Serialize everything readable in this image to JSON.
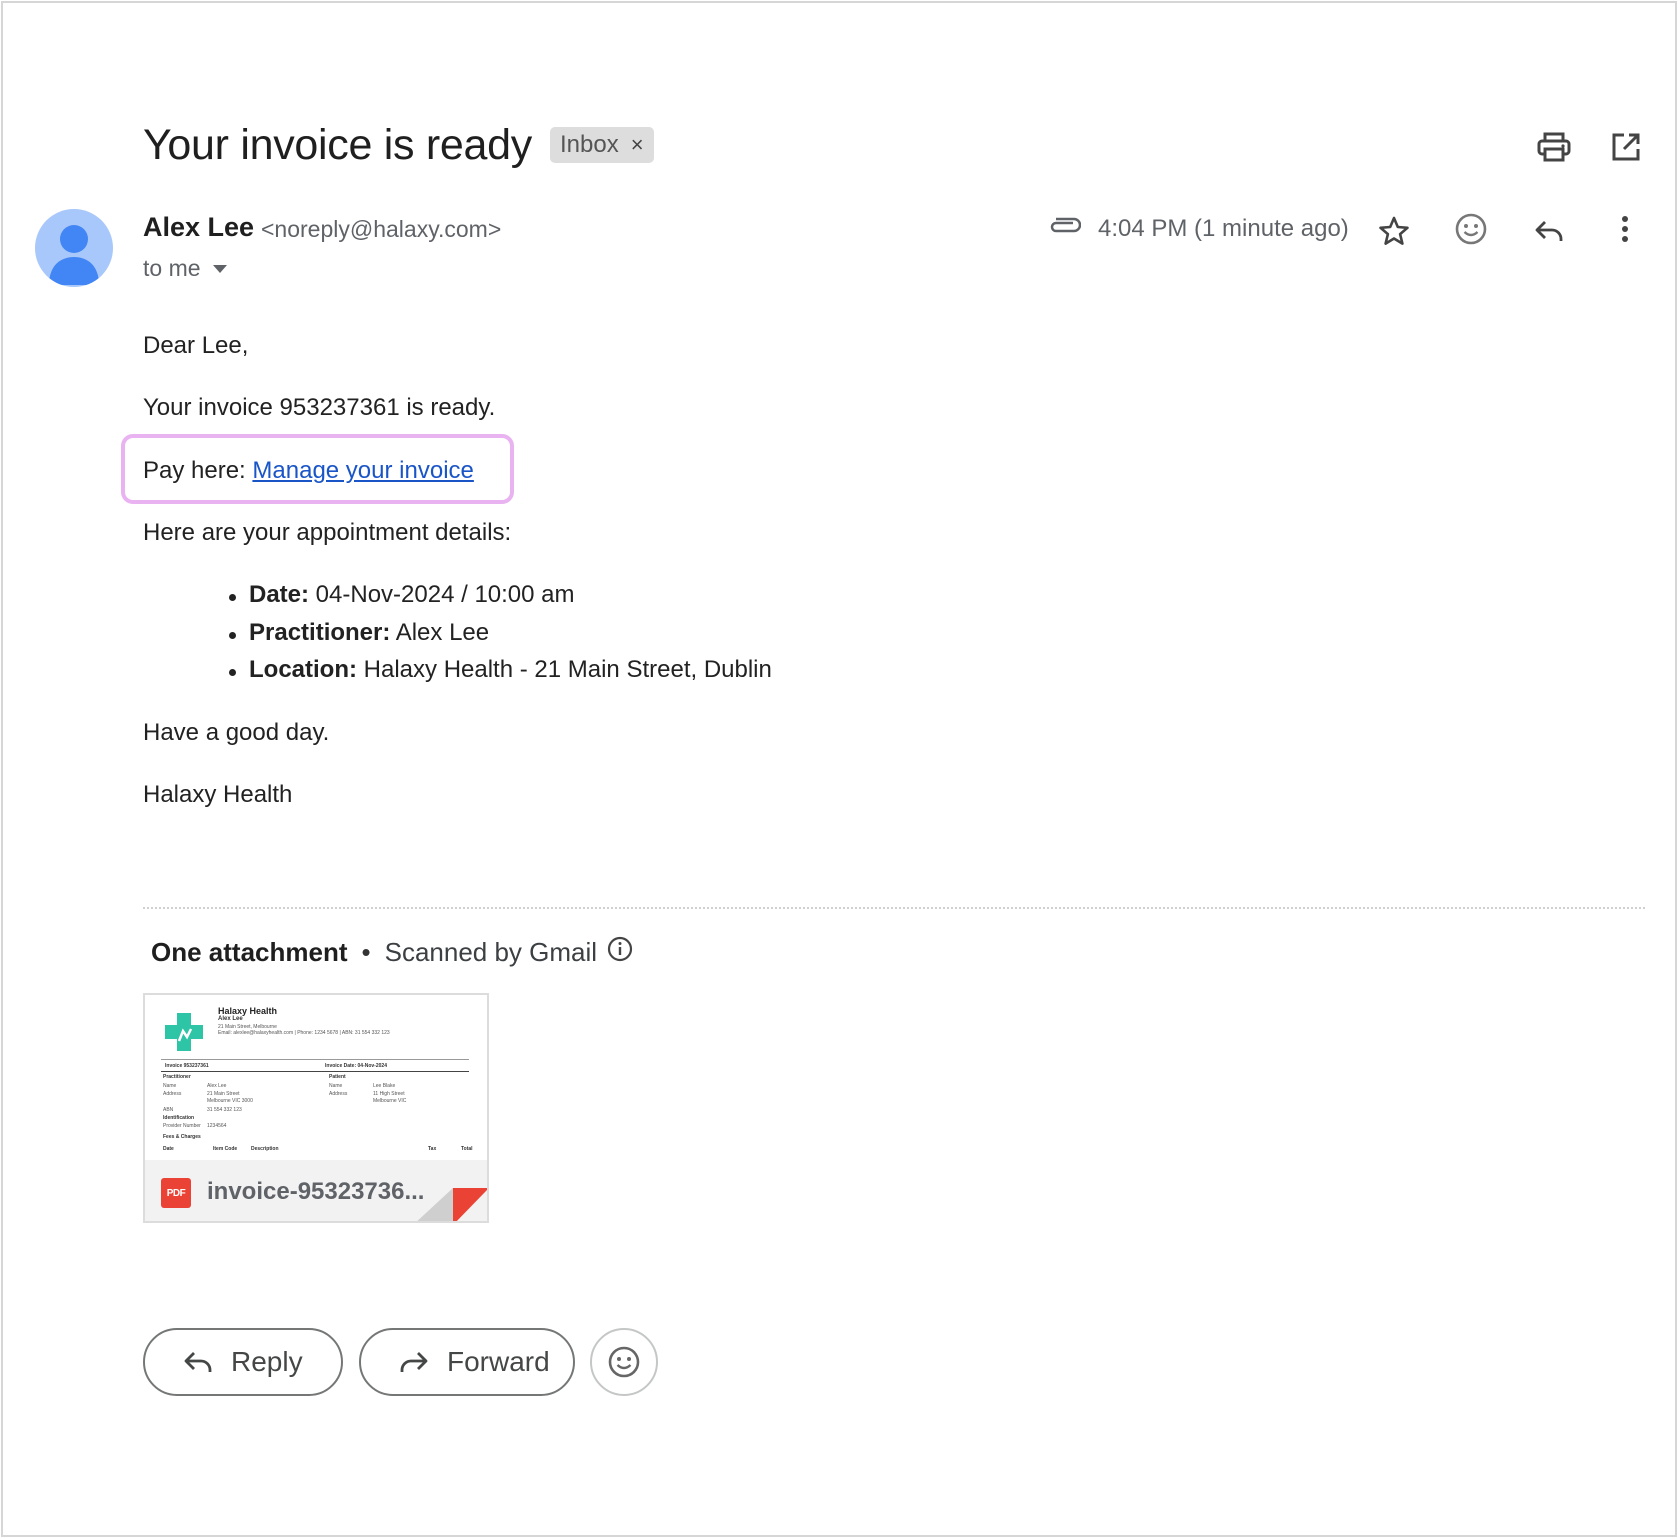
{
  "email": {
    "subject": "Your invoice is ready",
    "label": "Inbox",
    "label_remove": "×",
    "sender_name": "Alex Lee",
    "sender_email": "<noreply@halaxy.com>",
    "recipient": "to me",
    "timestamp": "4:04 PM (1 minute ago)"
  },
  "body": {
    "greeting": "Dear Lee,",
    "invoice_line": "Your invoice 953237361 is ready.",
    "pay_prefix": "Pay here: ",
    "pay_link": "Manage your invoice",
    "details_intro": "Here are your appointment details:",
    "details": [
      {
        "label": "Date:",
        "value": " 04-Nov-2024 / 10:00 am"
      },
      {
        "label": "Practitioner:",
        "value": " Alex Lee"
      },
      {
        "label": "Location:",
        "value": " Halaxy Health - 21 Main Street, Dublin"
      }
    ],
    "closing": "Have a good day.",
    "signature": "Halaxy Health"
  },
  "attachments": {
    "count_label": "One attachment",
    "separator": "•",
    "scanned_label": "Scanned by Gmail",
    "file_name": "invoice-95323736...",
    "file_type": "PDF",
    "thumbnail": {
      "org": "Halaxy Health",
      "person": "Alex Lee",
      "address": "21 Main Street, Melbourne",
      "contact": "Email: alexlee@halaxyhealth.com | Phone: 1234 5678 | ABN: 31 554 332 123",
      "invoice_no": "Invoice 953237361",
      "invoice_date": "Invoice Date: 04-Nov-2024",
      "practitioner_head": "Practitioner",
      "patient_head": "Patient",
      "name_label": "Name",
      "name_value": "Alex Lee",
      "address_label": "Address",
      "address_value_1": "21 Main Street",
      "address_value_2": "Melbourne VIC 3000",
      "abn_label": "ABN",
      "abn_value": "31 554 332 123",
      "patient_name": "Lee Blake",
      "patient_address_1": "11 High Street",
      "patient_address_2": "Melbourne VIC",
      "identification": "Identification",
      "provider_label": "Provider Number",
      "provider_value": "1234564",
      "fees": "Fees & Charges",
      "col_date": "Date",
      "col_item": "Item Code",
      "col_desc": "Description",
      "col_tax": "Tax",
      "col_total": "Total"
    }
  },
  "actions": {
    "reply": "Reply",
    "forward": "Forward"
  },
  "icons": [
    "print-icon",
    "open-in-new-window-icon",
    "attachment-clip-icon",
    "star-icon",
    "emoji-icon",
    "reply-icon",
    "more-vert-icon",
    "info-icon",
    "pdf-icon",
    "forward-icon",
    "chevron-down-icon",
    "avatar-person-icon"
  ],
  "colors": {
    "link": "#1a55c8",
    "highlight_border": "#e9b3f2",
    "avatar_bg": "#a8c7fa",
    "avatar_fg": "#4285f4",
    "pdf_red": "#ea4335",
    "thumb_accent": "#2ec4a6"
  }
}
